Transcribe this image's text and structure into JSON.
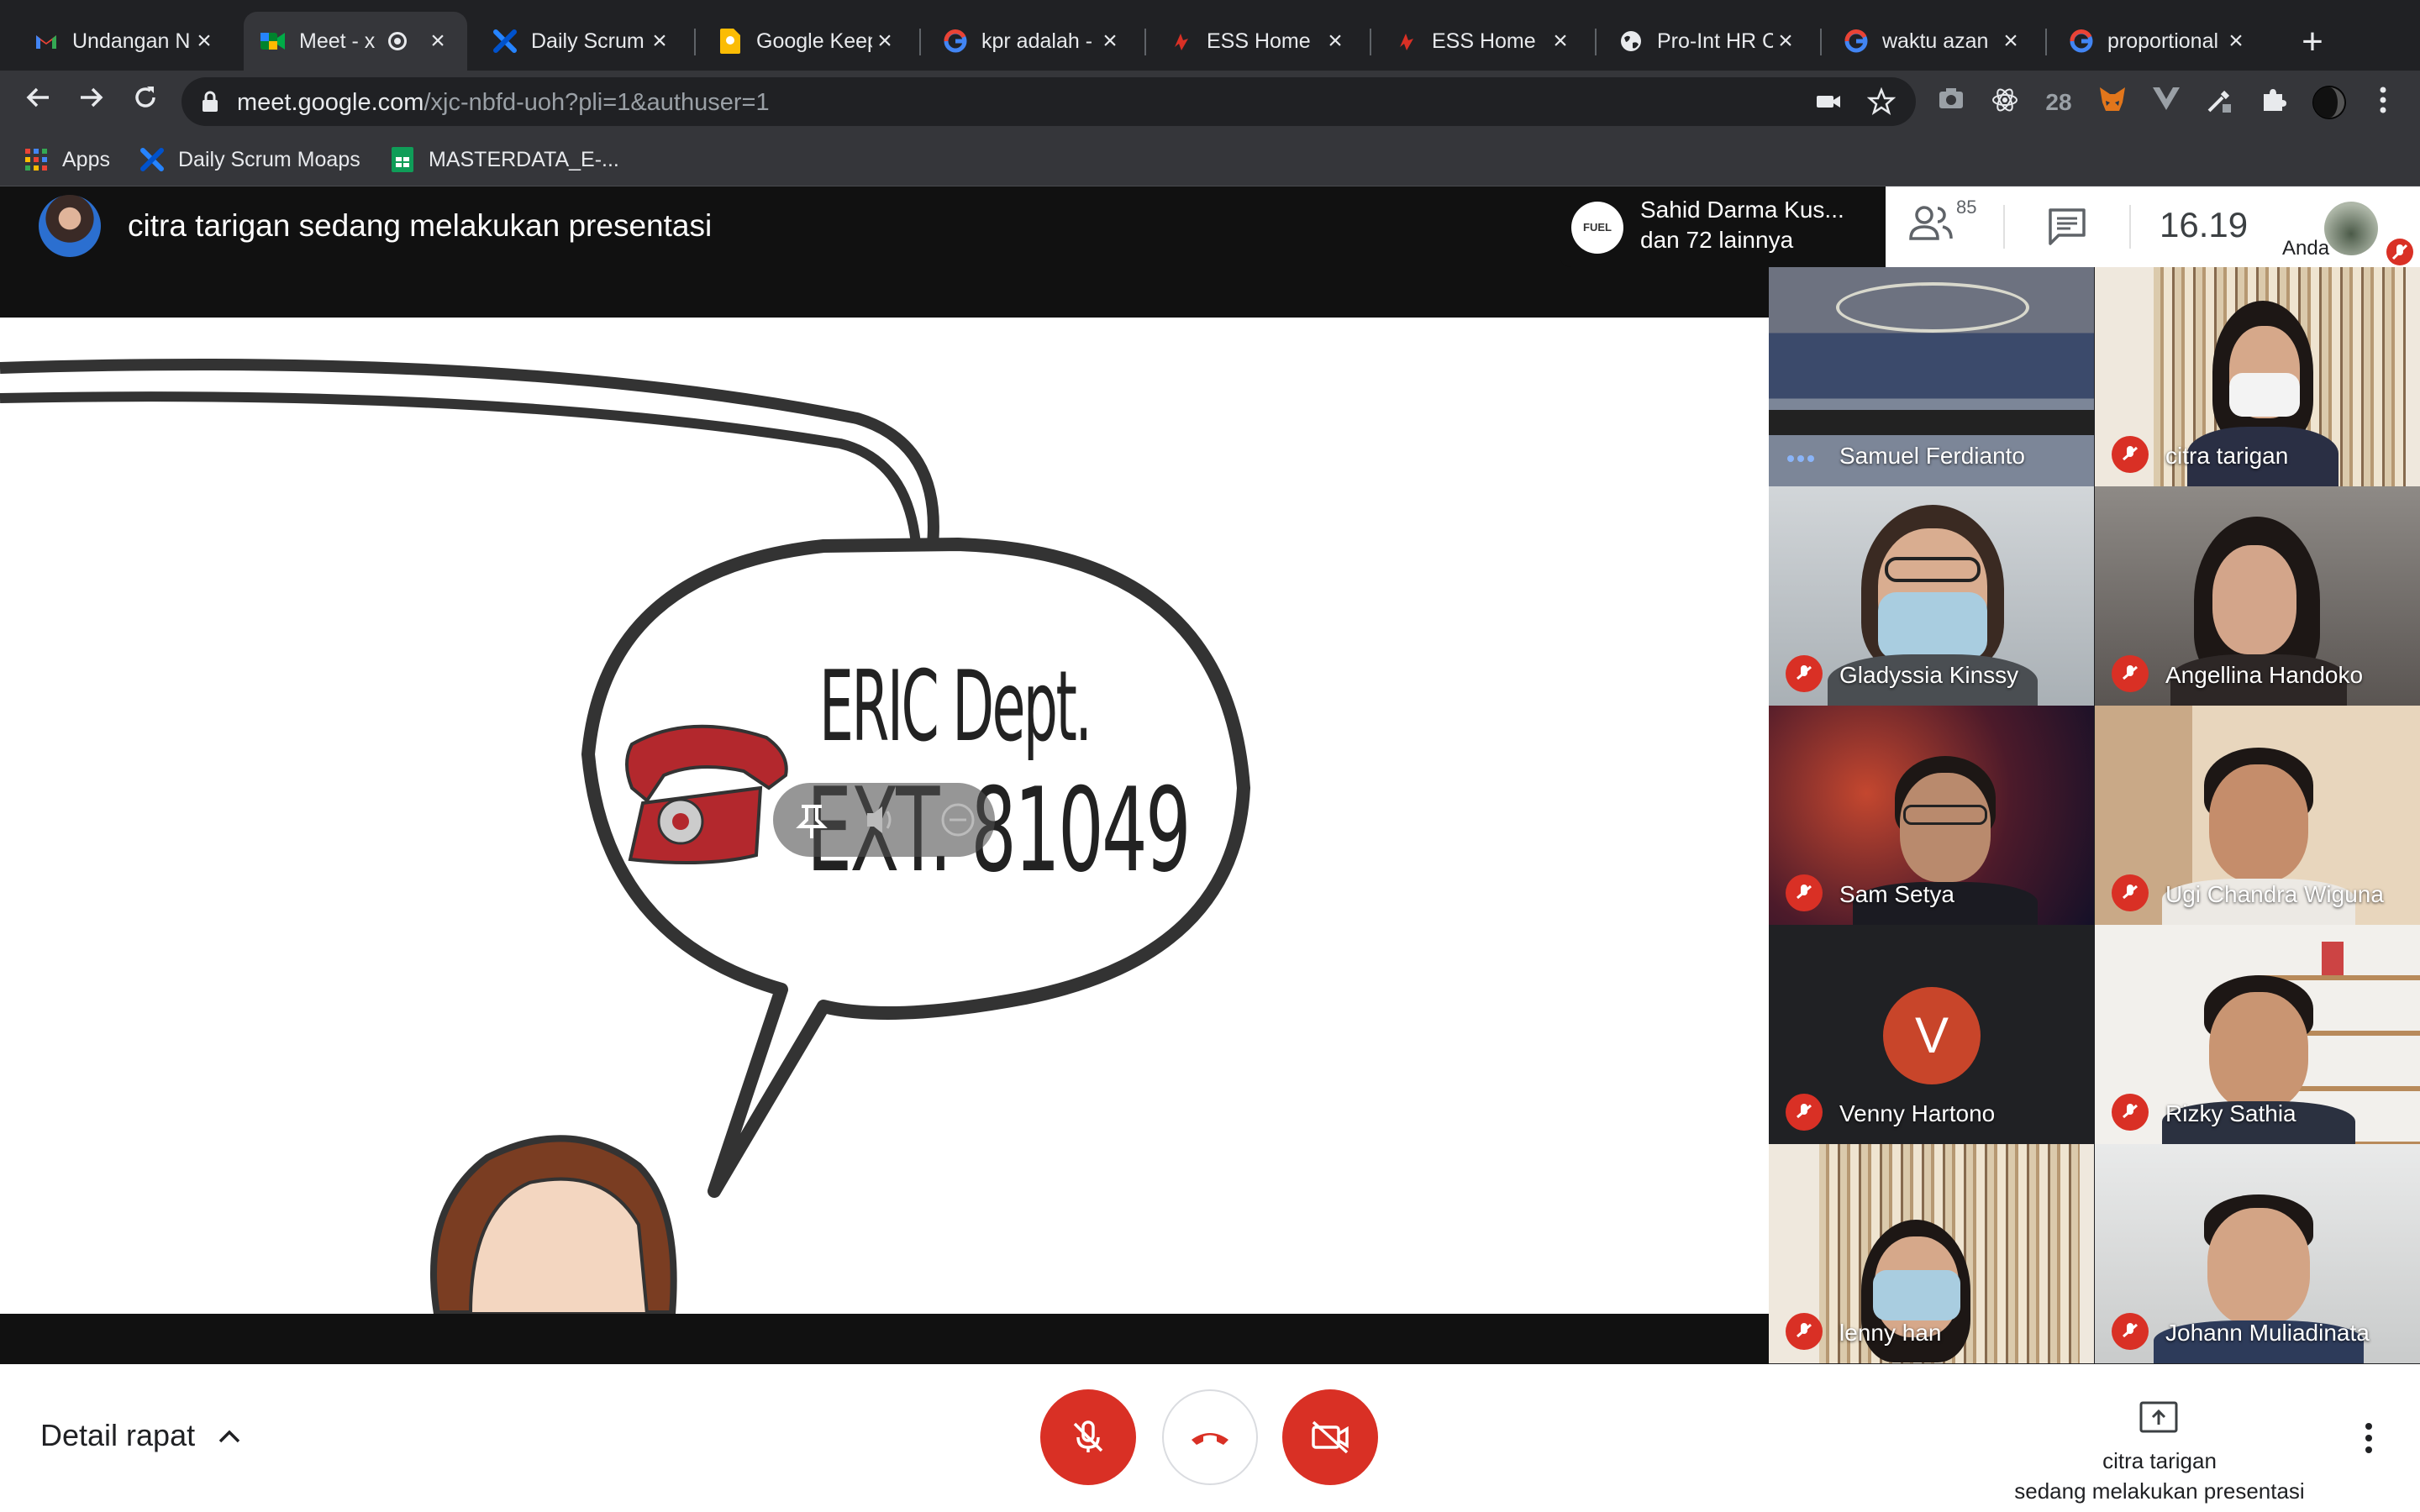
{
  "browser": {
    "tabs": [
      {
        "title": "Undangan N",
        "icon": "gmail-icon"
      },
      {
        "title": "Meet - x",
        "icon": "meet-icon",
        "active": true
      },
      {
        "title": "Daily Scrum",
        "icon": "jira-icon"
      },
      {
        "title": "Google Keep",
        "icon": "keep-icon"
      },
      {
        "title": "kpr adalah -",
        "icon": "google-icon"
      },
      {
        "title": "ESS Home",
        "icon": "ess-icon"
      },
      {
        "title": "ESS Home",
        "icon": "ess-icon"
      },
      {
        "title": "Pro-Int HR C",
        "icon": "globe-icon"
      },
      {
        "title": "waktu azan",
        "icon": "google-icon"
      },
      {
        "title": "proportional",
        "icon": "google-icon"
      }
    ],
    "new_tab_label": "+",
    "url_host": "meet.google.com",
    "url_path": "/xjc-nbfd-uoh?pli=1&authuser=1",
    "extension_badge": "28",
    "bookmarks": [
      {
        "label": "Apps",
        "icon": "apps-grid-icon"
      },
      {
        "label": "Daily Scrum Moaps",
        "icon": "jira-icon"
      },
      {
        "label": "MASTERDATA_E-...",
        "icon": "sheets-icon"
      }
    ]
  },
  "meet": {
    "presenter_banner": "citra tarigan sedang melakukan presentasi",
    "people_chip": {
      "line1": "Sahid Darma Kus...",
      "line2": "dan 72 lainnya"
    },
    "participant_count": "85",
    "clock": "16.19",
    "self_label": "Anda",
    "slide": {
      "line1": "ERIC Dept.",
      "line2": "EXT. 81049"
    },
    "participants": [
      {
        "name": "Samuel Ferdianto",
        "status": "speaking"
      },
      {
        "name": "citra tarigan",
        "status": "muted"
      },
      {
        "name": "Gladyssia Kinssy",
        "status": "muted"
      },
      {
        "name": "Angellina Handoko",
        "status": "muted"
      },
      {
        "name": "Sam Setya",
        "status": "muted"
      },
      {
        "name": "Ugi Chandra Wiguna",
        "status": "muted"
      },
      {
        "name": "Venny Hartono",
        "status": "muted",
        "avatar_letter": "V"
      },
      {
        "name": "Rizky Sathia",
        "status": "muted"
      },
      {
        "name": "lenny han",
        "status": "muted"
      },
      {
        "name": "Johann Muliadinata",
        "status": "muted"
      }
    ],
    "controls": {
      "meeting_details": "Detail rapat",
      "present_line1": "citra tarigan",
      "present_line2": "sedang melakukan presentasi"
    }
  },
  "colors": {
    "danger": "#d93025",
    "dark": "#202124",
    "accent": "#8ab4f8"
  }
}
